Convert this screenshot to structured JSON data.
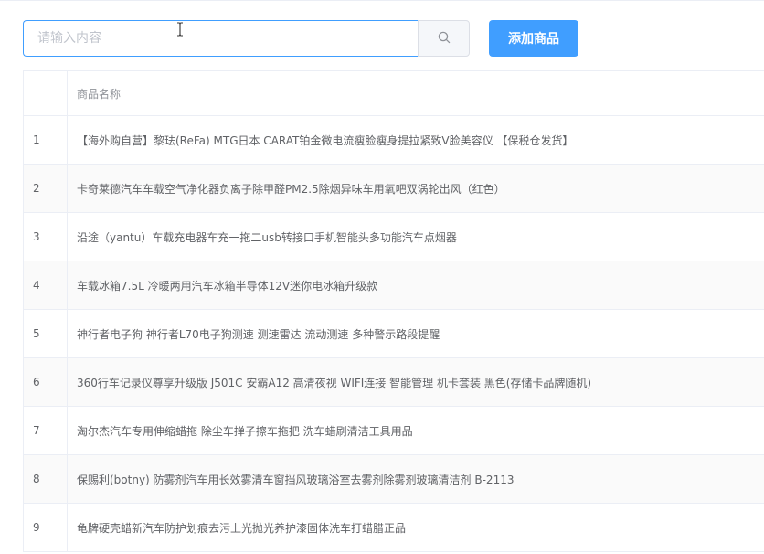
{
  "search": {
    "placeholder": "请输入内容",
    "value": ""
  },
  "toolbar": {
    "add_label": "添加商品"
  },
  "table": {
    "index_header": "",
    "name_header": "商品名称",
    "rows": [
      {
        "index": "1",
        "name": "【海外购自营】黎珐(ReFa) MTG日本 CARAT铂金微电流瘦脸瘦身提拉紧致V脸美容仪 【保税仓发货】"
      },
      {
        "index": "2",
        "name": "卡奇莱德汽车车载空气净化器负离子除甲醛PM2.5除烟异味车用氧吧双涡轮出风（红色）"
      },
      {
        "index": "3",
        "name": "沿途（yantu）车载充电器车充一拖二usb转接口手机智能头多功能汽车点烟器"
      },
      {
        "index": "4",
        "name": "车载冰箱7.5L 冷暖两用汽车冰箱半导体12V迷你电冰箱升级款"
      },
      {
        "index": "5",
        "name": "神行者电子狗 神行者L70电子狗测速 测速雷达 流动测速 多种警示路段提醒"
      },
      {
        "index": "6",
        "name": "360行车记录仪尊享升级版 J501C 安霸A12 高清夜视 WIFI连接 智能管理 机卡套装 黑色(存储卡品牌随机)"
      },
      {
        "index": "7",
        "name": "淘尔杰汽车专用伸缩蜡拖 除尘车掸子擦车拖把 洗车蜡刷清洁工具用品"
      },
      {
        "index": "8",
        "name": "保赐利(botny) 防雾剂汽车用长效雾清车窗挡风玻璃浴室去雾剂除雾剂玻璃清洁剂 B-2113"
      },
      {
        "index": "9",
        "name": "龟牌硬壳蜡新汽车防护划痕去污上光抛光养护漆固体洗车打蜡腊正品"
      }
    ]
  }
}
